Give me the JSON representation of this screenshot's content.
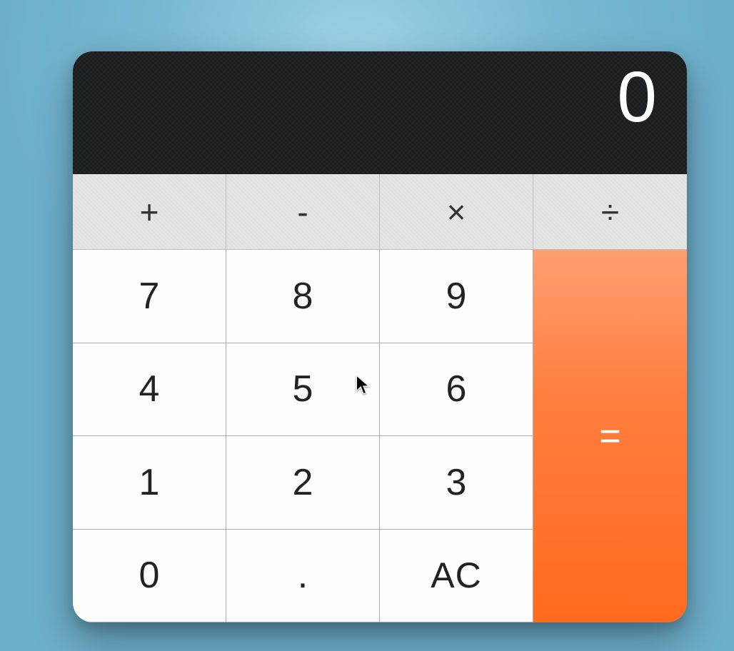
{
  "display": {
    "value": "0"
  },
  "operators": {
    "add": "+",
    "subtract": "-",
    "multiply": "×",
    "divide": "÷"
  },
  "keys": {
    "seven": "7",
    "eight": "8",
    "nine": "9",
    "four": "4",
    "five": "5",
    "six": "6",
    "one": "1",
    "two": "2",
    "three": "3",
    "zero": "0",
    "decimal": ".",
    "clear": "AC",
    "equals": "="
  },
  "colors": {
    "display_bg": "#1b1c1d",
    "operator_bg": "#e4e4e4",
    "key_bg": "#fdfdfd",
    "equals_gradient_top": "#ff9f71",
    "equals_gradient_bottom": "#ff6a1f",
    "page_bg": "#6daec9"
  }
}
